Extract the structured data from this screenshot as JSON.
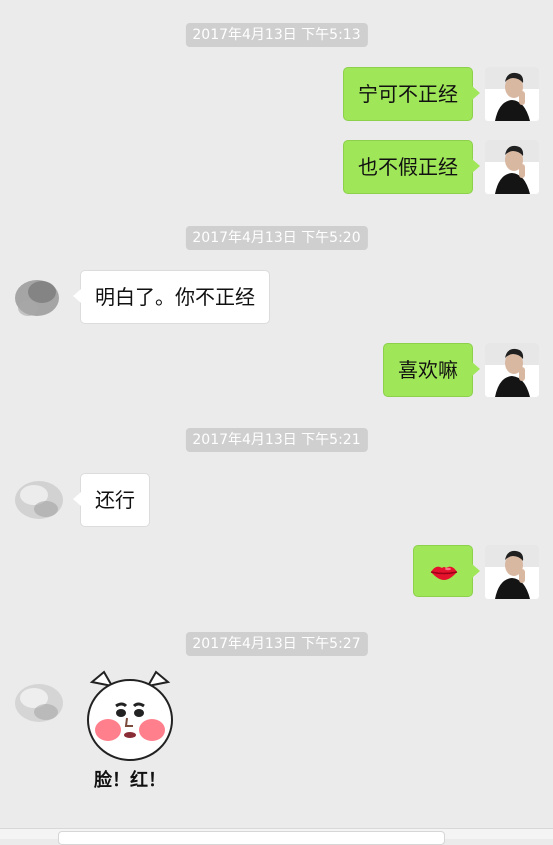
{
  "chat": {
    "timestamps": [
      "2017年4月13日 下午5:13",
      "2017年4月13日 下午5:20",
      "2017年4月13日 下午5:21",
      "2017年4月13日 下午5:27"
    ],
    "messages": [
      {
        "side": "right",
        "text": "宁可不正经"
      },
      {
        "side": "right",
        "text": "也不假正经"
      },
      {
        "side": "left",
        "text": "明白了。你不正经"
      },
      {
        "side": "right",
        "text": "喜欢嘛"
      },
      {
        "side": "left",
        "text": "还行"
      },
      {
        "side": "right",
        "sticker": "lips-emoji"
      },
      {
        "side": "left",
        "sticker": "blushing-pig-sticker",
        "sticker_text": "脸！红！"
      }
    ]
  },
  "colors": {
    "background": "#ebebeb",
    "own_bubble": "#9fe658",
    "other_bubble": "#ffffff",
    "timestamp_bg": "#cfcfcf"
  },
  "icons": {
    "own_avatar": "male-profile-photo-avatar",
    "other_avatar": "blurred-avatar",
    "lips": "lips-emoji",
    "sticker": "blushing-pig-sticker"
  }
}
